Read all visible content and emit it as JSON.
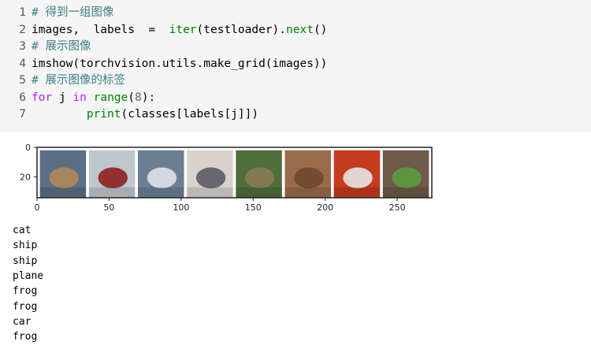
{
  "code_cell": {
    "lines": [
      {
        "no": "1",
        "tokens": [
          {
            "t": "# 得到一组图像",
            "cls": "cmt"
          }
        ]
      },
      {
        "no": "2",
        "tokens": [
          {
            "t": "images,  labels  =  ",
            "cls": ""
          },
          {
            "t": "iter",
            "cls": "bi"
          },
          {
            "t": "(testloader).",
            "cls": ""
          },
          {
            "t": "next",
            "cls": "bi"
          },
          {
            "t": "()",
            "cls": ""
          }
        ]
      },
      {
        "no": "3",
        "tokens": [
          {
            "t": "# 展示图像",
            "cls": "cmt"
          }
        ]
      },
      {
        "no": "4",
        "tokens": [
          {
            "t": "imshow(torchvision.utils.make_grid(images))",
            "cls": ""
          }
        ]
      },
      {
        "no": "5",
        "tokens": [
          {
            "t": "# 展示图像的标签",
            "cls": "cmt"
          }
        ]
      },
      {
        "no": "6",
        "tokens": [
          {
            "t": "for",
            "cls": "kw2"
          },
          {
            "t": " j ",
            "cls": ""
          },
          {
            "t": "in",
            "cls": "kw2"
          },
          {
            "t": " ",
            "cls": ""
          },
          {
            "t": "range",
            "cls": "bi"
          },
          {
            "t": "(",
            "cls": ""
          },
          {
            "t": "8",
            "cls": "num"
          },
          {
            "t": "):",
            "cls": ""
          }
        ]
      },
      {
        "no": "7",
        "tokens": [
          {
            "t": "        ",
            "cls": ""
          },
          {
            "t": "print",
            "cls": "bi"
          },
          {
            "t": "(classes[labels[j]])",
            "cls": ""
          }
        ]
      }
    ]
  },
  "plot": {
    "y_ticks": [
      "0",
      "20"
    ],
    "x_ticks": [
      "0",
      "50",
      "100",
      "150",
      "200",
      "250"
    ],
    "images": [
      {
        "label": "cat",
        "bg": "#5a6e86",
        "accent": "#b08a5a"
      },
      {
        "label": "ship",
        "bg": "#bfc6cc",
        "accent": "#8e2020"
      },
      {
        "label": "ship",
        "bg": "#6a7f93",
        "accent": "#dfe3e8"
      },
      {
        "label": "plane",
        "bg": "#d8d2cc",
        "accent": "#5b5b63"
      },
      {
        "label": "frog",
        "bg": "#4f6e3a",
        "accent": "#8a7a55"
      },
      {
        "label": "frog",
        "bg": "#9a6a4a",
        "accent": "#6e4a30"
      },
      {
        "label": "car",
        "bg": "#c63a1e",
        "accent": "#e6e6e6"
      },
      {
        "label": "frog",
        "bg": "#6e5a48",
        "accent": "#5d9a3e"
      }
    ]
  },
  "stdout": [
    "cat",
    "ship",
    "ship",
    "plane",
    "frog",
    "frog",
    "car",
    "frog"
  ]
}
